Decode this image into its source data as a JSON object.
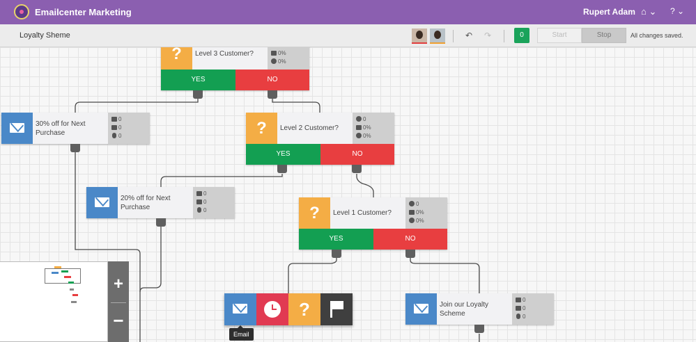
{
  "topbar": {
    "app_title": "Emailcenter Marketing",
    "user_name": "Rupert Adam",
    "home_menu": "⌂ ⌄",
    "help_menu": "? ⌄",
    "background_color": "#8b5fb0"
  },
  "toolbar": {
    "campaign_name": "Loyalty Sheme",
    "undo_icon": "↶",
    "redo_icon": "↷",
    "count": "0",
    "start_label": "Start",
    "stop_label": "Stop",
    "save_status": "All changes saved."
  },
  "nodes": {
    "q3": {
      "label": "Level 3 Customer?",
      "stat_check": "0%",
      "stat_cross": "0%",
      "yes": "YES",
      "no": "NO"
    },
    "q2": {
      "label": "Level 2 Customer?",
      "stat_people": "0",
      "stat_check": "0%",
      "stat_cross": "0%",
      "yes": "YES",
      "no": "NO"
    },
    "q1": {
      "label": "Level 1 Customer?",
      "stat_people": "0",
      "stat_check": "0%",
      "stat_cross": "0%",
      "yes": "YES",
      "no": "NO"
    },
    "e30": {
      "label": "30% off for Next Purchase",
      "stat_sent": "0",
      "stat_open": "0",
      "stat_click": "0"
    },
    "e20": {
      "label": "20% off for Next Purchase",
      "stat_sent": "0",
      "stat_open": "0",
      "stat_click": "0"
    },
    "ejoin": {
      "label": "Join our Loyalty Scheme",
      "stat_sent": "0",
      "stat_open": "0",
      "stat_click": "0"
    }
  },
  "palette": {
    "question_glyph": "?",
    "tooltip": "Email"
  },
  "zoom": {
    "in": "+",
    "out": "−"
  },
  "colors": {
    "question": "#f4ad45",
    "email": "#4a88c8",
    "yes": "#139f52",
    "no": "#e83e40",
    "wait": "#e13a52",
    "end": "#3f3f3f"
  }
}
